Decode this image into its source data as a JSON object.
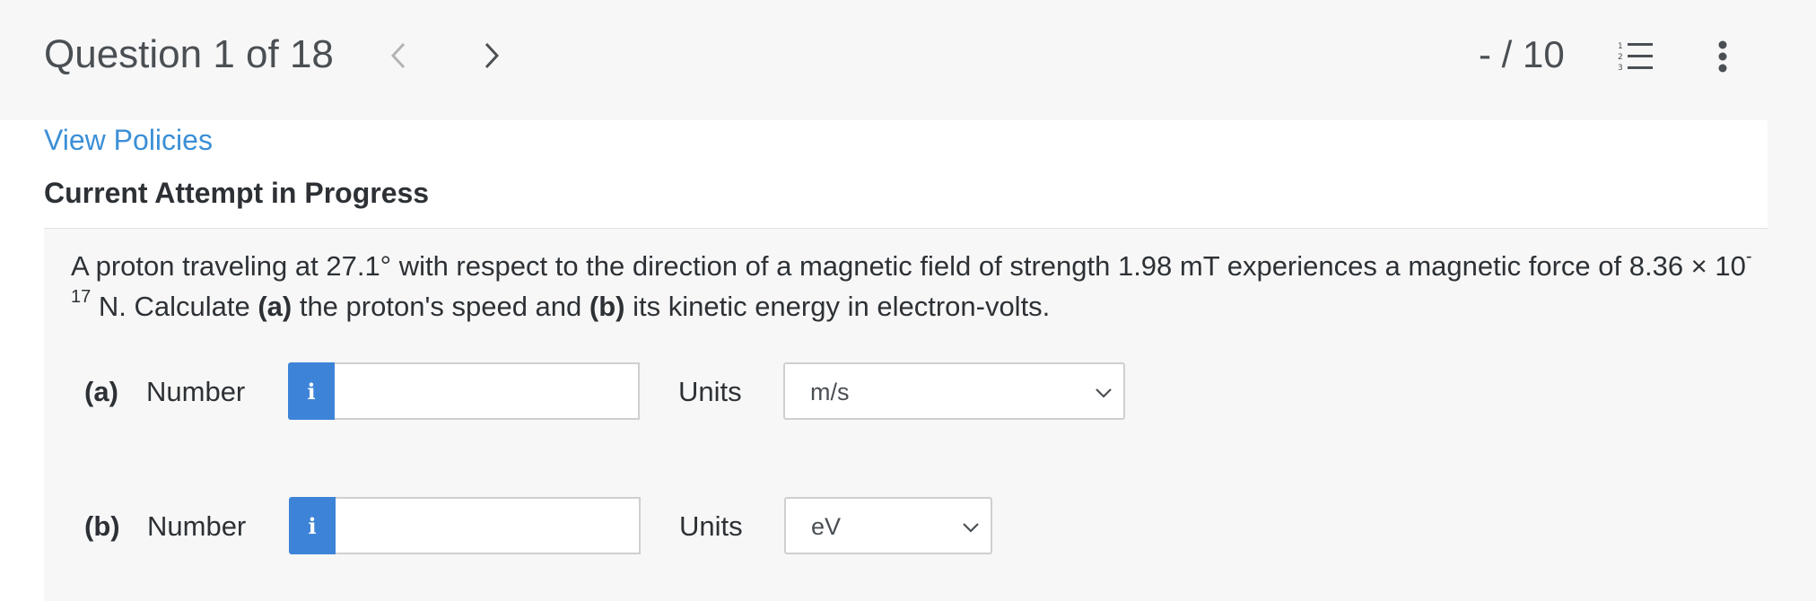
{
  "header": {
    "question_counter": "Question 1 of 18",
    "score": "- / 10",
    "prev_icon": "chevron-left-icon",
    "next_icon": "chevron-right-icon",
    "list_icon": "numbered-list-icon",
    "more_icon": "more-vertical-icon"
  },
  "policies_link": "View Policies",
  "attempt_heading": "Current Attempt in Progress",
  "question": {
    "text_1": "A proton traveling at 27.1° with respect to the direction of a magnetic field of strength 1.98 mT experiences a magnetic force of 8.36 × 10",
    "exponent": "-17",
    "text_2": " N. Calculate ",
    "part_a_bold": "(a)",
    "text_3": " the proton's speed and ",
    "part_b_bold": "(b)",
    "text_4": " its kinetic energy in electron-volts."
  },
  "parts": {
    "a": {
      "label": "(a)",
      "number_label": "Number",
      "info_glyph": "i",
      "number_value": "",
      "units_label": "Units",
      "units_selected": "m/s"
    },
    "b": {
      "label": "(b)",
      "number_label": "Number",
      "info_glyph": "i",
      "number_value": "",
      "units_label": "Units",
      "units_selected": "eV"
    }
  },
  "colors": {
    "accent": "#3d84d8",
    "link": "#3b8fd6",
    "page_bg": "#f7f7f7"
  }
}
